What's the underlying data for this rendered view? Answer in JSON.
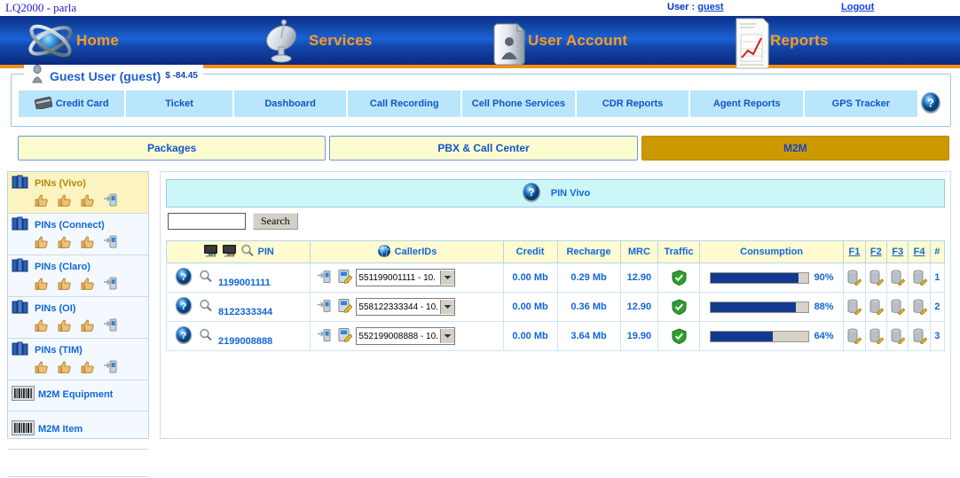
{
  "app": {
    "title": "LQ2000 - parla"
  },
  "topbar": {
    "user_label": "User :",
    "user_name": "guest",
    "logout": "Logout"
  },
  "nav": {
    "items": [
      {
        "label": "Home",
        "icon": "globe-icon"
      },
      {
        "label": "Services",
        "icon": "satellite-dish-icon"
      },
      {
        "label": "User Account",
        "icon": "user-account-icon"
      },
      {
        "label": "Reports",
        "icon": "report-chart-icon"
      }
    ]
  },
  "guest_panel": {
    "title": "Guest User (guest)",
    "balance": "$ -84.45",
    "tabs": [
      {
        "label": "Credit Card",
        "icon": "credit-card-icon"
      },
      {
        "label": "Ticket"
      },
      {
        "label": "Dashboard"
      },
      {
        "label": "Call Recording"
      },
      {
        "label": "Cell Phone Services"
      },
      {
        "label": "CDR Reports"
      },
      {
        "label": "Agent Reports"
      },
      {
        "label": "GPS Tracker"
      }
    ],
    "help_icon": "help-question-icon"
  },
  "section_tabs": [
    {
      "label": "Packages",
      "active": false
    },
    {
      "label": "PBX & Call Center",
      "active": false
    },
    {
      "label": "M2M",
      "active": true
    }
  ],
  "sidebar": {
    "items": [
      {
        "label": "PINs (Vivo)",
        "icon": "books-icon",
        "selected": true,
        "has_sub": true
      },
      {
        "label": "PINs (Connect)",
        "icon": "books-icon",
        "selected": false,
        "has_sub": true
      },
      {
        "label": "PINs (Claro)",
        "icon": "books-icon",
        "selected": false,
        "has_sub": true
      },
      {
        "label": "PINs (OI)",
        "icon": "books-icon",
        "selected": false,
        "has_sub": true
      },
      {
        "label": "PINs (TIM)",
        "icon": "books-icon",
        "selected": false,
        "has_sub": true
      },
      {
        "label": "M2M Equipment",
        "icon": "barcode-icon",
        "selected": false,
        "has_sub": false
      },
      {
        "label": "M2M Item",
        "icon": "barcode-icon",
        "selected": false,
        "has_sub": false
      }
    ],
    "sub_icons": [
      "thumb-up-icon",
      "thumb-up-icon",
      "thumb-up-icon",
      "phone-transfer-icon"
    ]
  },
  "main": {
    "banner": {
      "text": "PIN Vivo",
      "icon": "help-question-icon"
    },
    "search": {
      "value": "",
      "placeholder": "",
      "button_label": "Search"
    },
    "table": {
      "headers": {
        "pin": "PIN",
        "callerids": "CallerIDs",
        "credit": "Credit",
        "recharge": "Recharge",
        "mrc": "MRC",
        "traffic": "Traffic",
        "consumption": "Consumption",
        "f1": "F1",
        "f2": "F2",
        "f3": "F3",
        "f4": "F4",
        "hash": "#"
      },
      "rows": [
        {
          "pin": "1199001111",
          "callerid": "551199001111 - 10.",
          "credit": "0.00 Mb",
          "recharge": "0.29 Mb",
          "mrc": "12.90",
          "traffic": "ok",
          "consumption_pct": 90,
          "consumption_label": "90%",
          "index": "1"
        },
        {
          "pin": "8122333344",
          "callerid": "558122333344 - 10.",
          "credit": "0.00 Mb",
          "recharge": "0.36 Mb",
          "mrc": "12.90",
          "traffic": "ok",
          "consumption_pct": 88,
          "consumption_label": "88%",
          "index": "2"
        },
        {
          "pin": "2199008888",
          "callerid": "552199008888 - 10.",
          "credit": "0.00 Mb",
          "recharge": "3.64 Mb",
          "mrc": "19.90",
          "traffic": "ok",
          "consumption_pct": 64,
          "consumption_label": "64%",
          "index": "3"
        }
      ]
    }
  },
  "colors": {
    "nav_blue": "#11439f",
    "nav_accent_orange": "#f28f1c",
    "link_blue": "#1166dd",
    "tab_cyan": "#b9e6fb",
    "section_cream": "#fdfbd0",
    "section_active_gold": "#cc9900",
    "mrc_olive": "#c8c87a",
    "bar_navy": "#123a8f",
    "banner_cyan": "#ccf7f9",
    "sidebar_sel_yellow": "#fcf4c0"
  }
}
